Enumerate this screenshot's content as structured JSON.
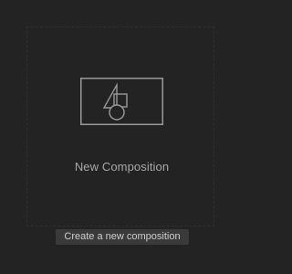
{
  "new_composition": {
    "label": "New Composition",
    "icon": "new-composition-icon",
    "tooltip": "Create a new composition"
  },
  "colors": {
    "background": "#232323",
    "icon_stroke": "#9a9a9a",
    "label": "#a8a8a8",
    "tooltip_bg": "#3a3a3a"
  }
}
